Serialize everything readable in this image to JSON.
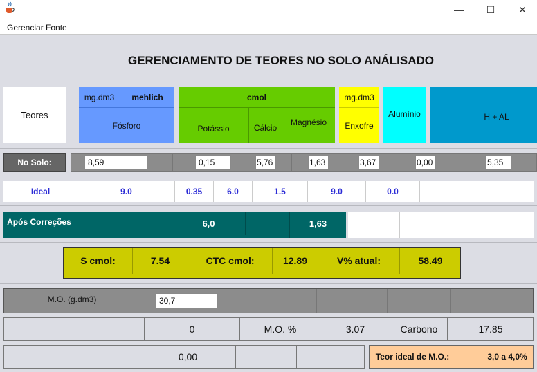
{
  "window": {
    "minimize": "—",
    "maximize": "☐",
    "close": "✕",
    "app_icon": "java-cup-icon"
  },
  "menu": {
    "item": "Gerenciar Fonte"
  },
  "title": "GERENCIAMENTO DE TEORES NO SOLO ANÁLISADO",
  "header": {
    "teores": "Teores",
    "fosforo_unit": "mg.dm3",
    "fosforo_method": "mehlich",
    "fosforo": "Fósforo",
    "cmol": "cmol",
    "potassio": "Potássio",
    "calcio": "Cálcio",
    "magnesio": "Magnésio",
    "enxofre_unit": "mg.dm3",
    "enxofre": "Enxofre",
    "aluminio": "Alumínio",
    "hal": "H + AL"
  },
  "no_solo": {
    "label": "No Solo:",
    "fosforo": "8,59",
    "potassio": "0,15",
    "calcio": "5,76",
    "magnesio": "1,63",
    "enxofre": "3,67",
    "aluminio": "0,00",
    "hal": "5,35"
  },
  "ideal": {
    "label": "Ideal",
    "fosforo": "9.0",
    "potassio": "0.35",
    "calcio": "6.0",
    "magnesio": "1.5",
    "enxofre": "9.0",
    "aluminio": "0.0"
  },
  "apos": {
    "label": "Após Correções",
    "calcio": "6,0",
    "magnesio": "1,63"
  },
  "summary": {
    "s_label": "S cmol:",
    "s_value": "7.54",
    "ctc_label": "CTC cmol:",
    "ctc_value": "12.89",
    "v_label": "V% atual:",
    "v_value": "58.49"
  },
  "mo": {
    "label": "M.O. (g.dm3)",
    "value": "30,7"
  },
  "row2": {
    "zero": "0",
    "mo_pct_label": "M.O. %",
    "mo_pct": "3.07",
    "carbono_label": "Carbono",
    "carbono": "17.85"
  },
  "row3": {
    "value": "0,00",
    "teor_label": "Teor ideal de M.O.:",
    "teor_value": "3,0 a 4,0%"
  },
  "colors": {
    "blue": "#6699ff",
    "green": "#66cc00",
    "yellow": "#ffff00",
    "cyan": "#00ffff",
    "teal_blue": "#0099cc",
    "dark_teal": "#006666",
    "olive": "#cccc00",
    "peach": "#ffcc99"
  }
}
